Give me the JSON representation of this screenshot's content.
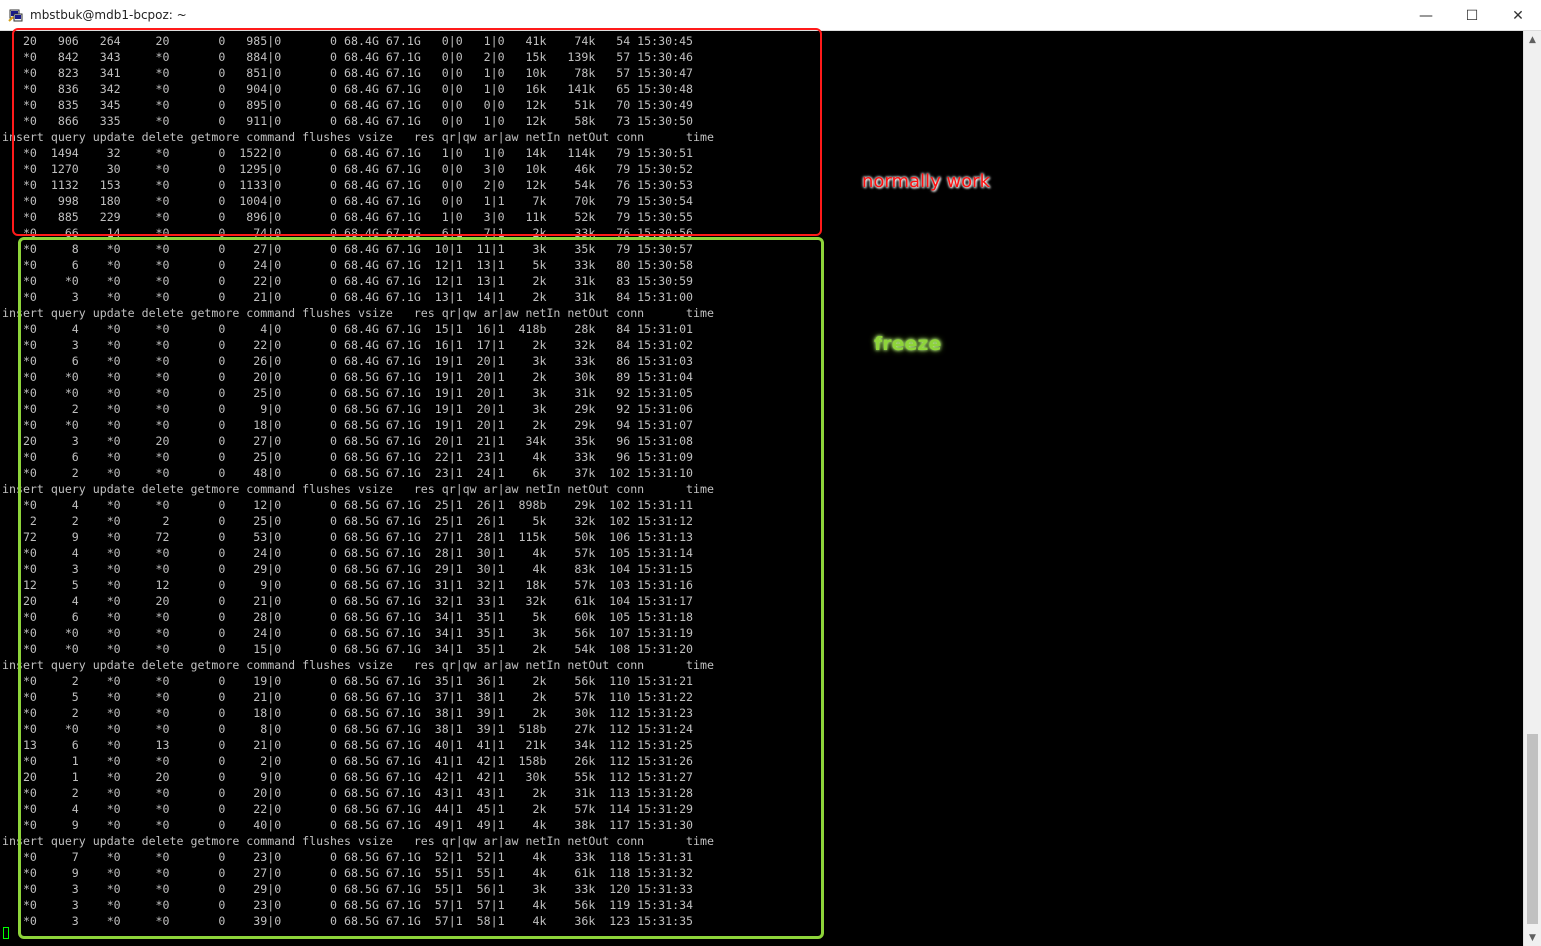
{
  "window": {
    "title": "mbstbuk@mdb1-bcpoz: ~",
    "minimize_symbol": "—",
    "maximize_symbol": "☐",
    "close_symbol": "✕",
    "icon": "putty-terminal-icon"
  },
  "terminal": {
    "lines": [
      "   20   906   264     20       0   985|0       0 68.4G 67.1G   0|0   1|0   41k    74k   54 15:30:45",
      "   *0   842   343     *0       0   884|0       0 68.4G 67.1G   0|0   2|0   15k   139k   57 15:30:46",
      "   *0   823   341     *0       0   851|0       0 68.4G 67.1G   0|0   1|0   10k    78k   57 15:30:47",
      "   *0   836   342     *0       0   904|0       0 68.4G 67.1G   0|0   1|0   16k   141k   65 15:30:48",
      "   *0   835   345     *0       0   895|0       0 68.4G 67.1G   0|0   0|0   12k    51k   70 15:30:49",
      "   *0   866   335     *0       0   911|0       0 68.4G 67.1G   0|0   1|0   12k    58k   73 15:30:50",
      "insert query update delete getmore command flushes vsize   res qr|qw ar|aw netIn netOut conn      time",
      "   *0  1494    32     *0       0  1522|0       0 68.4G 67.1G   1|0   1|0   14k   114k   79 15:30:51",
      "   *0  1270    30     *0       0  1295|0       0 68.4G 67.1G   0|0   3|0   10k    46k   79 15:30:52",
      "   *0  1132   153     *0       0  1133|0       0 68.4G 67.1G   0|0   2|0   12k    54k   76 15:30:53",
      "   *0   998   180     *0       0  1004|0       0 68.4G 67.1G   0|0   1|1    7k    70k   79 15:30:54",
      "   *0   885   229     *0       0   896|0       0 68.4G 67.1G   1|0   3|0   11k    52k   79 15:30:55",
      "   *0    66    14     *0       0    74|0       0 68.4G 67.1G   6|1   7|1    2k    33k   76 15:30:56",
      "   *0     8    *0     *0       0    27|0       0 68.4G 67.1G  10|1  11|1    3k    35k   79 15:30:57",
      "   *0     6    *0     *0       0    24|0       0 68.4G 67.1G  12|1  13|1    5k    33k   80 15:30:58",
      "   *0    *0    *0     *0       0    22|0       0 68.4G 67.1G  12|1  13|1    2k    31k   83 15:30:59",
      "   *0     3    *0     *0       0    21|0       0 68.4G 67.1G  13|1  14|1    2k    31k   84 15:31:00",
      "insert query update delete getmore command flushes vsize   res qr|qw ar|aw netIn netOut conn      time",
      "   *0     4    *0     *0       0     4|0       0 68.4G 67.1G  15|1  16|1  418b    28k   84 15:31:01",
      "   *0     3    *0     *0       0    22|0       0 68.4G 67.1G  16|1  17|1    2k    32k   84 15:31:02",
      "   *0     6    *0     *0       0    26|0       0 68.4G 67.1G  19|1  20|1    3k    33k   86 15:31:03",
      "   *0    *0    *0     *0       0    20|0       0 68.5G 67.1G  19|1  20|1    2k    30k   89 15:31:04",
      "   *0    *0    *0     *0       0    25|0       0 68.5G 67.1G  19|1  20|1    3k    31k   92 15:31:05",
      "   *0     2    *0     *0       0     9|0       0 68.5G 67.1G  19|1  20|1    3k    29k   92 15:31:06",
      "   *0    *0    *0     *0       0    18|0       0 68.5G 67.1G  19|1  20|1    2k    29k   94 15:31:07",
      "   20     3    *0     20       0    27|0       0 68.5G 67.1G  20|1  21|1   34k    35k   96 15:31:08",
      "   *0     6    *0     *0       0    25|0       0 68.5G 67.1G  22|1  23|1    4k    33k   96 15:31:09",
      "   *0     2    *0     *0       0    48|0       0 68.5G 67.1G  23|1  24|1    6k    37k  102 15:31:10",
      "insert query update delete getmore command flushes vsize   res qr|qw ar|aw netIn netOut conn      time",
      "   *0     4    *0     *0       0    12|0       0 68.5G 67.1G  25|1  26|1  898b    29k  102 15:31:11",
      "    2     2    *0      2       0    25|0       0 68.5G 67.1G  25|1  26|1    5k    32k  102 15:31:12",
      "   72     9    *0     72       0    53|0       0 68.5G 67.1G  27|1  28|1  115k    50k  106 15:31:13",
      "   *0     4    *0     *0       0    24|0       0 68.5G 67.1G  28|1  30|1    4k    57k  105 15:31:14",
      "   *0     3    *0     *0       0    29|0       0 68.5G 67.1G  29|1  30|1    4k    83k  104 15:31:15",
      "   12     5    *0     12       0     9|0       0 68.5G 67.1G  31|1  32|1   18k    57k  103 15:31:16",
      "   20     4    *0     20       0    21|0       0 68.5G 67.1G  32|1  33|1   32k    61k  104 15:31:17",
      "   *0     6    *0     *0       0    28|0       0 68.5G 67.1G  34|1  35|1    5k    60k  105 15:31:18",
      "   *0    *0    *0     *0       0    24|0       0 68.5G 67.1G  34|1  35|1    3k    56k  107 15:31:19",
      "   *0    *0    *0     *0       0    15|0       0 68.5G 67.1G  34|1  35|1    2k    54k  108 15:31:20",
      "insert query update delete getmore command flushes vsize   res qr|qw ar|aw netIn netOut conn      time",
      "   *0     2    *0     *0       0    19|0       0 68.5G 67.1G  35|1  36|1    2k    56k  110 15:31:21",
      "   *0     5    *0     *0       0    21|0       0 68.5G 67.1G  37|1  38|1    2k    57k  110 15:31:22",
      "   *0     2    *0     *0       0    18|0       0 68.5G 67.1G  38|1  39|1    2k    30k  112 15:31:23",
      "   *0    *0    *0     *0       0     8|0       0 68.5G 67.1G  38|1  39|1  518b    27k  112 15:31:24",
      "   13     6    *0     13       0    21|0       0 68.5G 67.1G  40|1  41|1   21k    34k  112 15:31:25",
      "   *0     1    *0     *0       0     2|0       0 68.5G 67.1G  41|1  42|1  158b    26k  112 15:31:26",
      "   20     1    *0     20       0     9|0       0 68.5G 67.1G  42|1  42|1   30k    55k  112 15:31:27",
      "   *0     2    *0     *0       0    20|0       0 68.5G 67.1G  43|1  43|1    2k    31k  113 15:31:28",
      "   *0     4    *0     *0       0    22|0       0 68.5G 67.1G  44|1  45|1    2k    57k  114 15:31:29",
      "   *0     9    *0     *0       0    40|0       0 68.5G 67.1G  49|1  49|1    4k    38k  117 15:31:30",
      "insert query update delete getmore command flushes vsize   res qr|qw ar|aw netIn netOut conn      time",
      "   *0     7    *0     *0       0    23|0       0 68.5G 67.1G  52|1  52|1    4k    33k  118 15:31:31",
      "   *0     9    *0     *0       0    27|0       0 68.5G 67.1G  55|1  55|1    4k    61k  118 15:31:32",
      "   *0     3    *0     *0       0    29|0       0 68.5G 67.1G  55|1  56|1    3k    33k  120 15:31:33",
      "   *0     3    *0     *0       0    23|0       0 68.5G 67.1G  57|1  57|1    4k    56k  119 15:31:34",
      "   *0     3    *0     *0       0    39|0       0 68.5G 67.1G  57|1  58|1    4k    36k  123 15:31:35"
    ],
    "text_color": "#c0c0c0",
    "background": "#000000"
  },
  "scrollbar": {
    "up_symbol": "▲",
    "down_symbol": "▼"
  },
  "annotations": {
    "normal_label": "normally work",
    "freeze_label": "freeze",
    "normal_color": "#ff1a1a",
    "freeze_color": "#8ed43a"
  }
}
